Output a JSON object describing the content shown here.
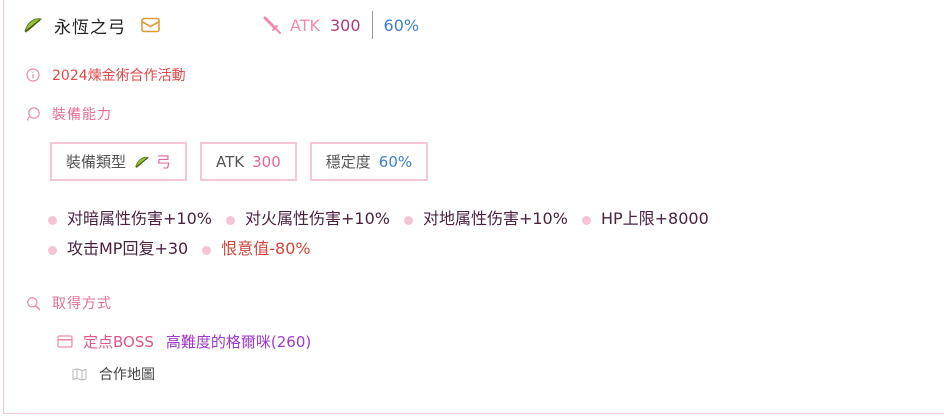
{
  "item": {
    "name": "永恆之弓",
    "weapon_icon": "bow-icon",
    "tag_icon": "mail-tag-icon"
  },
  "head_stats": {
    "atk_icon": "sword-icon",
    "atk_label": "ATK",
    "atk_value": "300",
    "stability_value": "60%"
  },
  "event": {
    "icon": "info-icon",
    "text": "2024煉金術合作活動"
  },
  "abilities_section": {
    "icon": "ability-icon",
    "title": "裝備能力"
  },
  "chips": {
    "type_label": "裝備類型",
    "type_value": "弓",
    "atk_label": "ATK",
    "atk_value": "300",
    "stability_label": "穩定度",
    "stability_value": "60%"
  },
  "abilities": [
    {
      "text": "对暗属性伤害+10%"
    },
    {
      "text": "对火属性伤害+10%"
    },
    {
      "text": "对地属性伤害+10%"
    },
    {
      "text": "HP上限+8000"
    },
    {
      "text": "攻击MP回复+30"
    },
    {
      "text": "恨意值-80%"
    }
  ],
  "obtain_section": {
    "icon": "search-icon",
    "title": "取得方式"
  },
  "source": {
    "icon": "card-icon",
    "type": "定点BOSS",
    "name": "高難度的格爾咪(260)"
  },
  "map": {
    "icon": "map-icon",
    "text": "合作地圖"
  },
  "colors": {
    "accent_pink": "#e86d96",
    "chip_border": "#f4c6d6",
    "stat_blue": "#3c7fd0",
    "negative_red": "#d0453c"
  }
}
